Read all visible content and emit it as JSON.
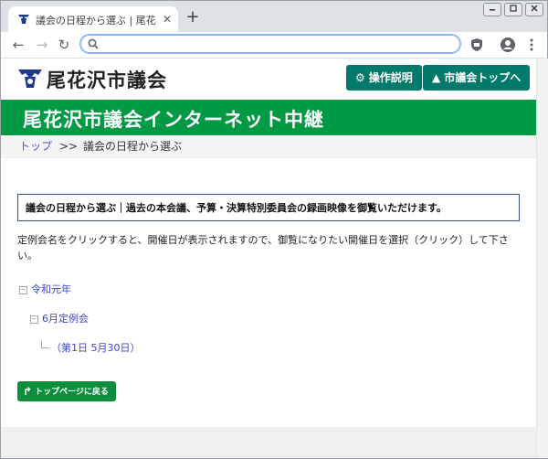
{
  "browser": {
    "tab_title": "議会の日程から選ぶ | 尾花沢市議会",
    "close_glyph": "✕",
    "new_tab_glyph": "+",
    "back_glyph": "←",
    "forward_glyph": "→",
    "reload_glyph": "↻",
    "omnibox_value": ""
  },
  "site": {
    "logo_text": "尾花沢市議会",
    "buttons": {
      "help": "操作説明",
      "top": "市議会トップへ"
    },
    "band_title": "尾花沢市議会インターネット中継"
  },
  "breadcrumb": {
    "home": "トップ",
    "separator": ">>",
    "current": "議会の日程から選ぶ"
  },
  "notice": "議会の日程から選ぶ｜過去の本会議、予算・決算特別委員会の録画映像を御覧いただけます。",
  "description": "定例会名をクリックすると、開催日が表示されますので、御覧になりたい開催日を選択（クリック）して下さい。",
  "tree": {
    "year": "令和元年",
    "session": "6月定例会",
    "day": "（第1日 5月30日）",
    "expanded_glyph": "−"
  },
  "back_button": "トップページに戻る",
  "colors": {
    "accent_teal": "#007b6b",
    "band_green": "#009944",
    "link_blue": "#3a47c2"
  }
}
